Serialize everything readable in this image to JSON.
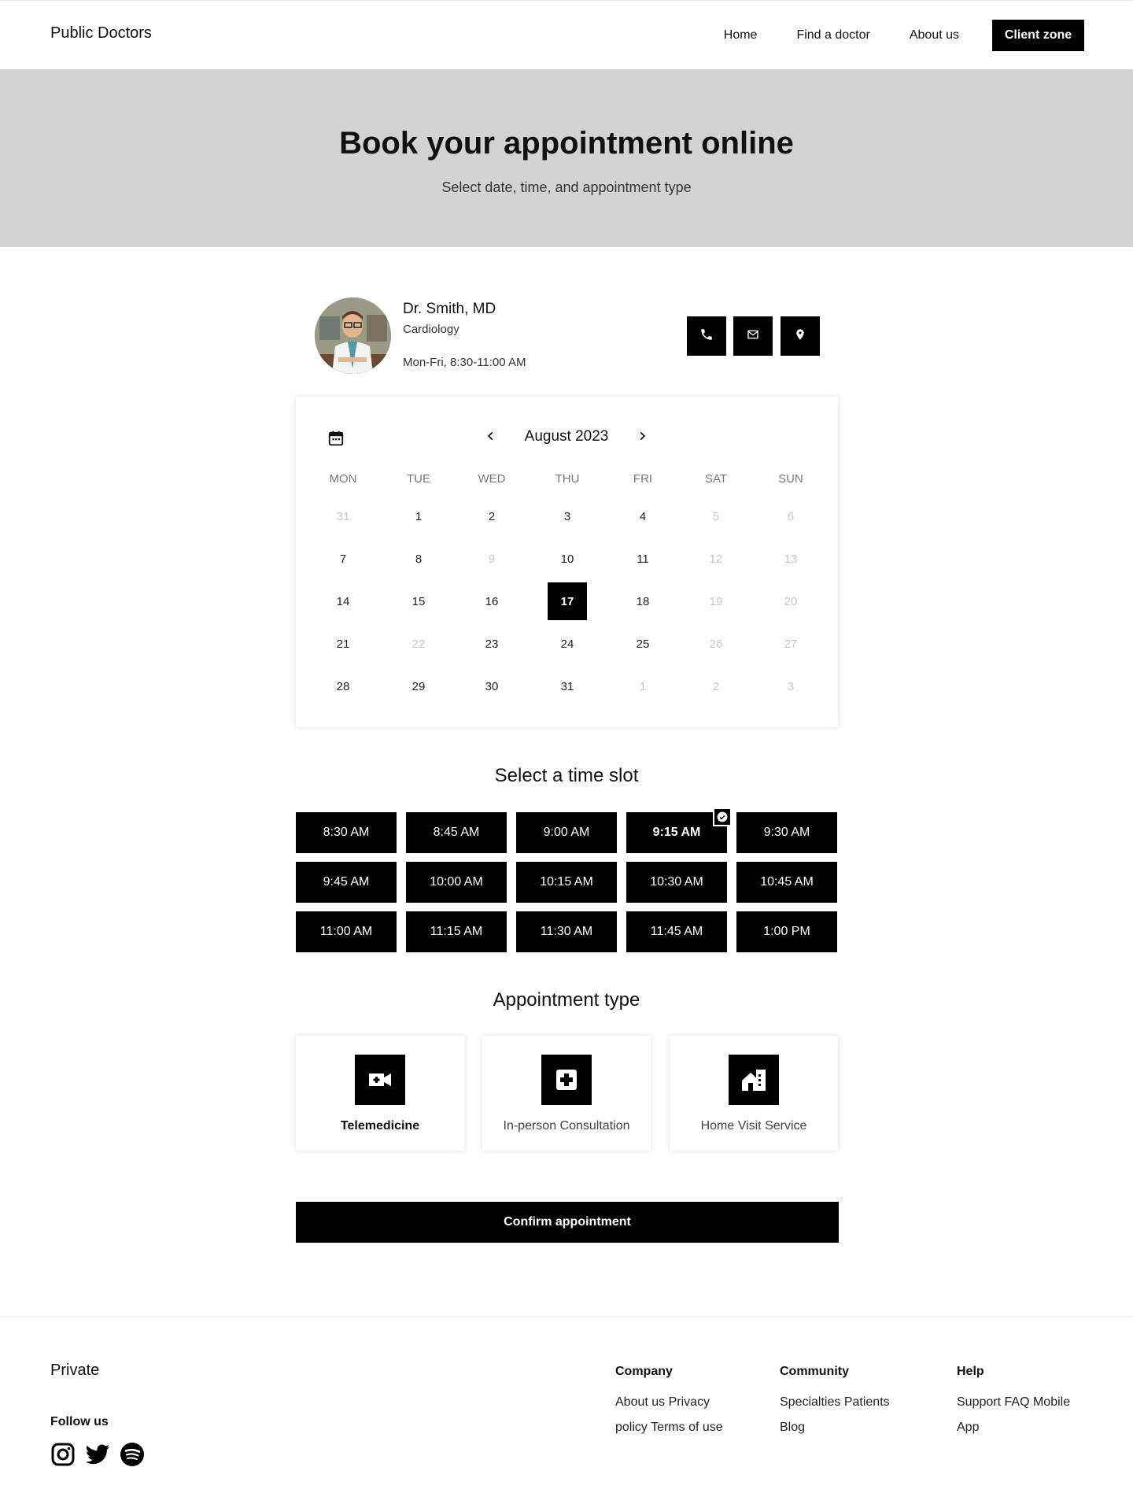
{
  "header": {
    "brand": "Public Doctors",
    "nav": [
      {
        "label": "Home"
      },
      {
        "label": "Find a doctor"
      },
      {
        "label": "About us"
      }
    ],
    "cta": "Client zone"
  },
  "hero": {
    "title": "Book your appointment online",
    "subtitle": "Select date, time, and appointment type"
  },
  "doctor": {
    "name": "Dr. Smith, MD",
    "specialty": "Cardiology",
    "hours": "Mon-Fri, 8:30-11:00 AM",
    "contact_icons": [
      "phone-icon",
      "mail-icon",
      "location-pin-icon"
    ]
  },
  "calendar": {
    "month": "August 2023",
    "weekdays": [
      "MON",
      "TUE",
      "WED",
      "THU",
      "FRI",
      "SAT",
      "SUN"
    ],
    "weeks": [
      [
        {
          "d": "31",
          "m": true
        },
        {
          "d": "1"
        },
        {
          "d": "2"
        },
        {
          "d": "3"
        },
        {
          "d": "4"
        },
        {
          "d": "5",
          "m": true
        },
        {
          "d": "6",
          "m": true
        }
      ],
      [
        {
          "d": "7"
        },
        {
          "d": "8"
        },
        {
          "d": "9",
          "m": true
        },
        {
          "d": "10"
        },
        {
          "d": "11"
        },
        {
          "d": "12",
          "m": true
        },
        {
          "d": "13",
          "m": true
        }
      ],
      [
        {
          "d": "14"
        },
        {
          "d": "15"
        },
        {
          "d": "16"
        },
        {
          "d": "17",
          "s": true
        },
        {
          "d": "18"
        },
        {
          "d": "19",
          "m": true
        },
        {
          "d": "20",
          "m": true
        }
      ],
      [
        {
          "d": "21"
        },
        {
          "d": "22",
          "m": true
        },
        {
          "d": "23"
        },
        {
          "d": "24"
        },
        {
          "d": "25"
        },
        {
          "d": "26",
          "m": true
        },
        {
          "d": "27",
          "m": true
        }
      ],
      [
        {
          "d": "28"
        },
        {
          "d": "29"
        },
        {
          "d": "30"
        },
        {
          "d": "31"
        },
        {
          "d": "1",
          "m": true
        },
        {
          "d": "2",
          "m": true
        },
        {
          "d": "3",
          "m": true
        }
      ]
    ]
  },
  "timeslots": {
    "title": "Select a time slot",
    "slots": [
      "8:30 AM",
      "8:45 AM",
      "9:00 AM",
      "9:15 AM",
      "9:30 AM",
      "9:45 AM",
      "10:00 AM",
      "10:15 AM",
      "10:30 AM",
      "10:45 AM",
      "11:00 AM",
      "11:15 AM",
      "11:30 AM",
      "11:45 AM",
      "1:00 PM"
    ],
    "selected": "9:15 AM"
  },
  "appointment": {
    "title": "Appointment type",
    "types": [
      {
        "label": "Telemedicine",
        "icon": "video-add-icon",
        "active": true
      },
      {
        "label": "In-person Consultation",
        "icon": "medical-cross-icon",
        "active": false
      },
      {
        "label": "Home Visit Service",
        "icon": "home-icon",
        "active": false
      }
    ],
    "confirm": "Confirm appointment"
  },
  "footer": {
    "brand": "Private",
    "follow": "Follow us",
    "social_icons": [
      "instagram-icon",
      "twitter-icon",
      "spotify-icon"
    ],
    "columns": [
      {
        "title": "Company",
        "links": [
          "About us",
          "Privacy policy",
          "Terms of use"
        ]
      },
      {
        "title": "Community",
        "links": [
          "Specialties",
          "Patients",
          "Blog"
        ]
      },
      {
        "title": "Help",
        "links": [
          "Support",
          "FAQ",
          "Mobile App"
        ]
      }
    ]
  },
  "colors": {
    "accent": "#000000",
    "hero_bg": "#d3d3d3",
    "muted_text": "#c7c7c7"
  }
}
